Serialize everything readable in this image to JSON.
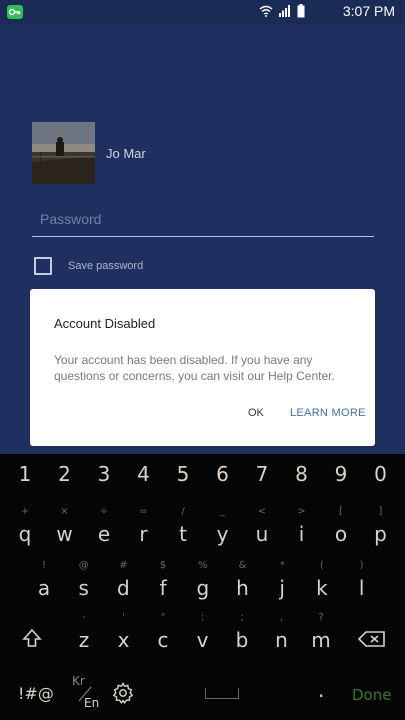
{
  "status_bar": {
    "time": "3:07 PM",
    "app_icon": "key-icon",
    "icons": [
      "wifi-icon",
      "signal-icon",
      "battery-icon"
    ]
  },
  "account": {
    "username": "Jo Mar",
    "password_placeholder": "Password",
    "save_password_label": "Save password"
  },
  "dialog": {
    "title": "Account Disabled",
    "message": "Your account has been disabled. If you have any questions or concerns, you can visit our Help Center.",
    "ok_label": "OK",
    "learn_more_label": "LEARN MORE"
  },
  "keyboard": {
    "number_row": [
      "1",
      "2",
      "3",
      "4",
      "5",
      "6",
      "7",
      "8",
      "9",
      "0"
    ],
    "row1": [
      {
        "main": "q",
        "sub": "+"
      },
      {
        "main": "w",
        "sub": "×"
      },
      {
        "main": "e",
        "sub": "÷"
      },
      {
        "main": "r",
        "sub": "="
      },
      {
        "main": "t",
        "sub": "/"
      },
      {
        "main": "y",
        "sub": "_"
      },
      {
        "main": "u",
        "sub": "<"
      },
      {
        "main": "i",
        "sub": ">"
      },
      {
        "main": "o",
        "sub": "["
      },
      {
        "main": "p",
        "sub": "]"
      }
    ],
    "row2": [
      {
        "main": "a",
        "sub": "!"
      },
      {
        "main": "s",
        "sub": "@"
      },
      {
        "main": "d",
        "sub": "#"
      },
      {
        "main": "f",
        "sub": "$"
      },
      {
        "main": "g",
        "sub": "%"
      },
      {
        "main": "h",
        "sub": "&"
      },
      {
        "main": "j",
        "sub": "*"
      },
      {
        "main": "k",
        "sub": "("
      },
      {
        "main": "l",
        "sub": ")"
      }
    ],
    "row3": [
      {
        "main": "z",
        "sub": "-"
      },
      {
        "main": "x",
        "sub": "'"
      },
      {
        "main": "c",
        "sub": "\""
      },
      {
        "main": "v",
        "sub": ":"
      },
      {
        "main": "b",
        "sub": ";"
      },
      {
        "main": "n",
        "sub": ","
      },
      {
        "main": "m",
        "sub": "?"
      }
    ],
    "symbols_label": "!#@",
    "lang_top": "Kr",
    "lang_bottom": "En",
    "period": ".",
    "done_label": "Done",
    "colors": {
      "done": "#2e7a2e",
      "key_text": "#d8d4c2"
    }
  },
  "colors": {
    "app_background": "#1f3060",
    "dialog_accent": "#3f6fb6"
  }
}
